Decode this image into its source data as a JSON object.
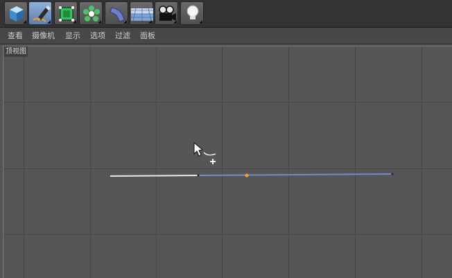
{
  "toolbar": {
    "tools": [
      {
        "name": "cube-icon"
      },
      {
        "name": "pen-spline-icon"
      },
      {
        "name": "subdivision-cube-icon"
      },
      {
        "name": "cloner-gear-icon"
      },
      {
        "name": "deformer-bend-icon"
      },
      {
        "name": "floor-plane-icon"
      },
      {
        "name": "camera-icon"
      },
      {
        "name": "light-bulb-icon"
      }
    ],
    "active_tool": "pen-spline-icon"
  },
  "menu": {
    "items": [
      "查看",
      "摄像机",
      "显示",
      "选项",
      "过滤",
      "面板"
    ]
  },
  "viewport": {
    "label": "顶视图"
  },
  "colors": {
    "background": "#545454",
    "grid": "#474747",
    "spline_white": "#e8e8e8",
    "spline_blue": "#6a8fd6",
    "point_orange": "#f0a020"
  }
}
